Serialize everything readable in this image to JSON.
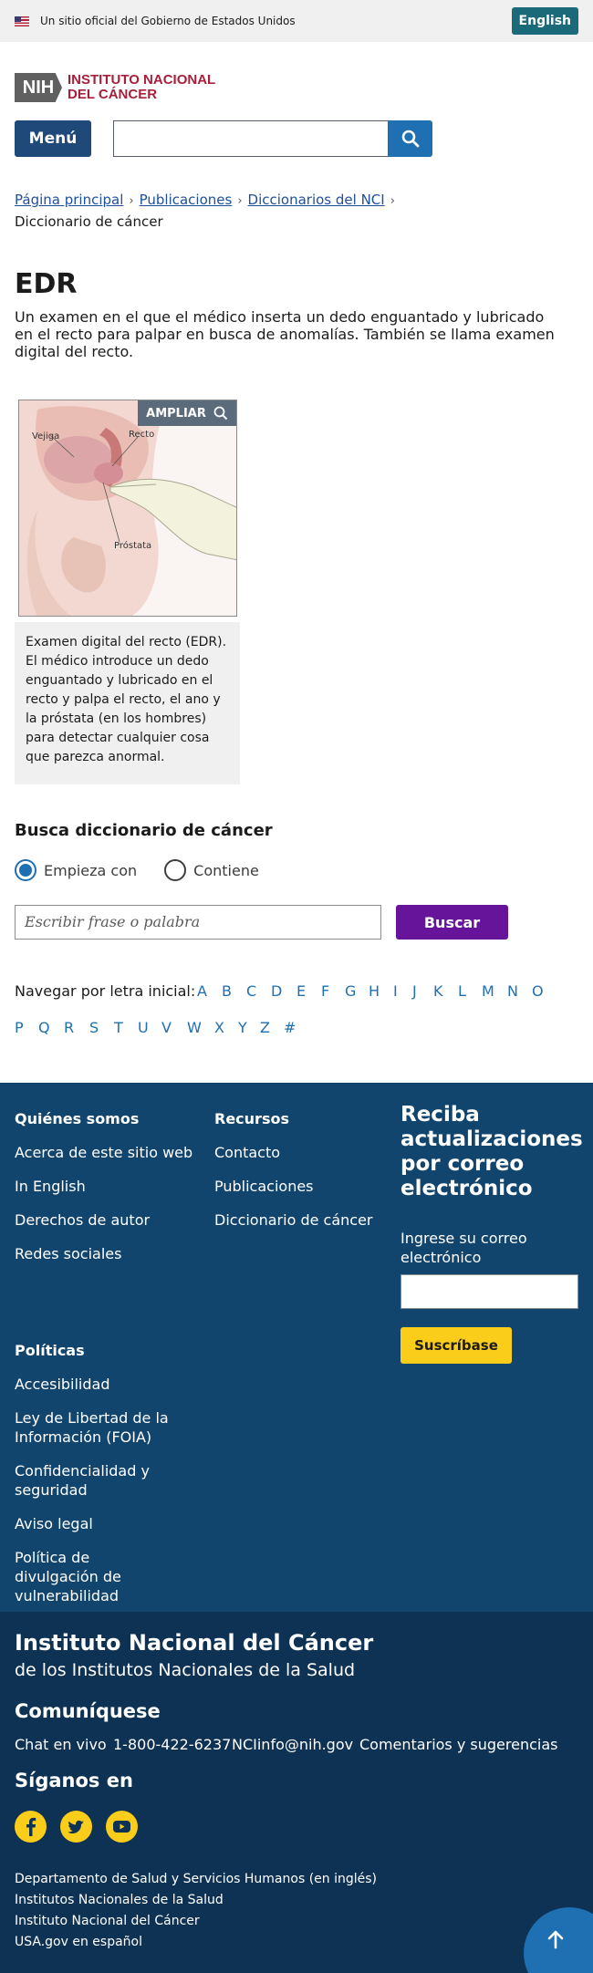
{
  "gov_banner": {
    "text": "Un sitio oficial del Gobierno de Estados Unidos",
    "lang_button": "English"
  },
  "logo": {
    "mark": "NIH",
    "line1": "INSTITUTO NACIONAL",
    "line2": "DEL CÁNCER"
  },
  "nav": {
    "menu_label": "Menú",
    "search_value": ""
  },
  "breadcrumb": {
    "items": [
      "Página principal",
      "Publicaciones",
      "Diccionarios del NCI"
    ],
    "current": "Diccionario de cáncer"
  },
  "term": {
    "title": "EDR",
    "definition": "Un examen en el que el médico inserta un dedo enguantado y lubricado en el recto para palpar en busca de anomalías. También se llama examen digital del recto."
  },
  "figure": {
    "enlarge_label": "AMPLIAR",
    "labels": {
      "bladder": "Vejiga",
      "rectum": "Recto",
      "prostate": "Próstata"
    },
    "caption": "Examen digital del recto (EDR). El médico introduce un dedo enguantado y lubricado en el recto y palpa el recto, el ano y la próstata (en los hombres) para detectar cualquier cosa que parezca anormal."
  },
  "dictionary_search": {
    "heading": "Busca diccionario de cáncer",
    "options": [
      "Empieza con",
      "Contiene"
    ],
    "selected": "Empieza con",
    "placeholder": "Escribir frase o palabra",
    "button": "Buscar",
    "letters_label": "Navegar por letra inicial:",
    "letters": [
      "A",
      "B",
      "C",
      "D",
      "E",
      "F",
      "G",
      "H",
      "I",
      "J",
      "K",
      "L",
      "M",
      "N",
      "O",
      "P",
      "Q",
      "R",
      "S",
      "T",
      "U",
      "V",
      "W",
      "X",
      "Y",
      "Z",
      "#"
    ]
  },
  "footer": {
    "about": {
      "heading": "Quiénes somos",
      "links": [
        "Acerca de este sitio web",
        "In English",
        "Derechos de autor",
        "Redes sociales"
      ]
    },
    "resources": {
      "heading": "Recursos",
      "links": [
        "Contacto",
        "Publicaciones",
        "Diccionario de cáncer"
      ]
    },
    "policies": {
      "heading": "Políticas",
      "links": [
        "Accesibilidad",
        "Ley de Libertad de la Información (FOIA)",
        "Confidencialidad y seguridad",
        "Aviso legal",
        "Política de divulgación de vulnerabilidad"
      ]
    },
    "signup": {
      "title": "Reciba actualizaciones por correo electrónico",
      "label": "Ingrese su correo electrónico",
      "button": "Suscríbase"
    },
    "org_name": "Instituto Nacional del Cáncer",
    "org_sub": "de los Institutos Nacionales de la Salud",
    "contact_heading": "Comuníquese",
    "contact_items": [
      "Chat en vivo",
      "1-800-422-6237",
      "NCIinfo@nih.gov",
      "Comentarios y sugerencias"
    ],
    "follow_heading": "Síganos en",
    "social": [
      "facebook-icon",
      "twitter-icon",
      "youtube-icon"
    ],
    "agency_links": [
      "Departamento de Salud y Servicios Humanos (en inglés)",
      "Institutos Nacionales de la Salud",
      "Instituto Nacional del Cáncer",
      "USA.gov en español"
    ]
  },
  "colors": {
    "accent_blue": "#1f6fb3",
    "menu_navy": "#1f4978",
    "search_purple": "#66149a",
    "footer_blue": "#12456d",
    "footer_dark": "#0e3253",
    "signup_yellow": "#facd1b",
    "nci_red": "#a71f3b"
  }
}
